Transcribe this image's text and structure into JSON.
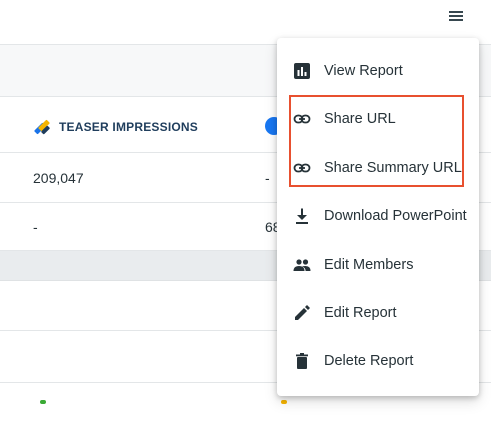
{
  "header": {
    "menu_icon": "hamburger-icon"
  },
  "table": {
    "column_header": {
      "icon": "teaser-brand-icon",
      "label": "TEASER IMPRESSIONS"
    },
    "second_column_icon": "facebook-icon",
    "rows": [
      {
        "teaser_impressions": "209,047",
        "second_col": "-"
      },
      {
        "teaser_impressions": "-",
        "second_col": "68"
      }
    ]
  },
  "menu": {
    "items": [
      {
        "label": "View Report",
        "icon": "bar-chart-icon"
      },
      {
        "label": "Share URL",
        "icon": "link-icon"
      },
      {
        "label": "Share Summary URL",
        "icon": "link-icon"
      },
      {
        "label": "Download PowerPoint",
        "icon": "download-icon"
      },
      {
        "label": "Edit Members",
        "icon": "people-icon"
      },
      {
        "label": "Edit Report",
        "icon": "pencil-icon"
      },
      {
        "label": "Delete Report",
        "icon": "trash-icon"
      }
    ]
  },
  "colors": {
    "highlight": "#e8502f",
    "text": "#263238",
    "header_text": "#1f3d5c",
    "grey_band": "#e9ecee"
  }
}
